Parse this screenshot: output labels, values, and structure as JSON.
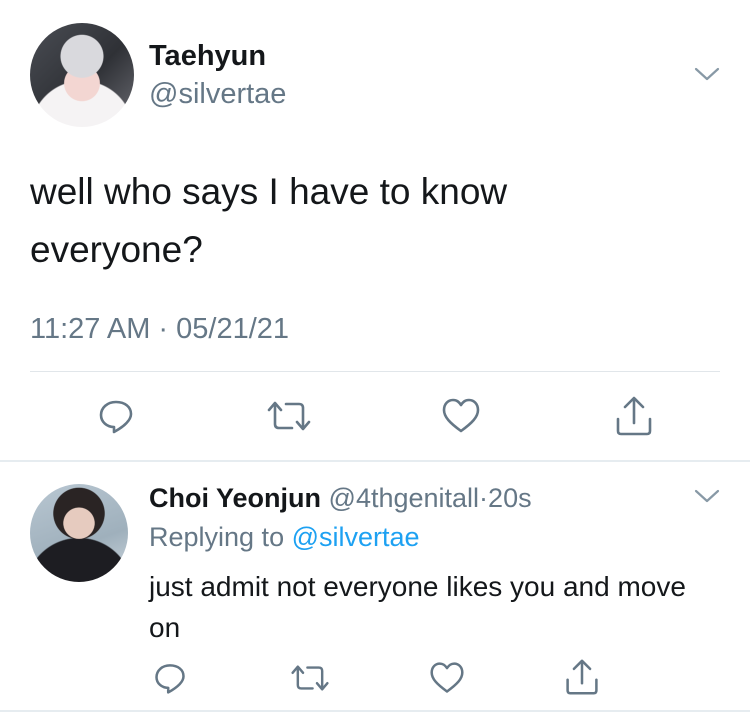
{
  "tweet": {
    "display_name": "Taehyun",
    "handle": "@silvertae",
    "text": "well who says I have to know everyone?",
    "timestamp": "11:27 AM · 05/21/21",
    "menu_icon": "chevron-down-icon",
    "actions": [
      "reply-icon",
      "retweet-icon",
      "like-icon",
      "share-icon"
    ]
  },
  "reply": {
    "display_name": "Choi Yeonjun",
    "handle": "@4thgenitall",
    "time_separator": "·",
    "time_ago": "20s",
    "replying_prefix": "Replying to",
    "replying_to": "@silvertae",
    "text": "just admit not everyone likes you and move on",
    "menu_icon": "chevron-down-icon",
    "actions": [
      "reply-icon",
      "retweet-icon",
      "like-icon",
      "share-icon"
    ]
  },
  "colors": {
    "text": "#14171a",
    "secondary": "#657786",
    "link": "#1da1f2",
    "divider": "#e1e6ea",
    "icon": "#657786"
  }
}
